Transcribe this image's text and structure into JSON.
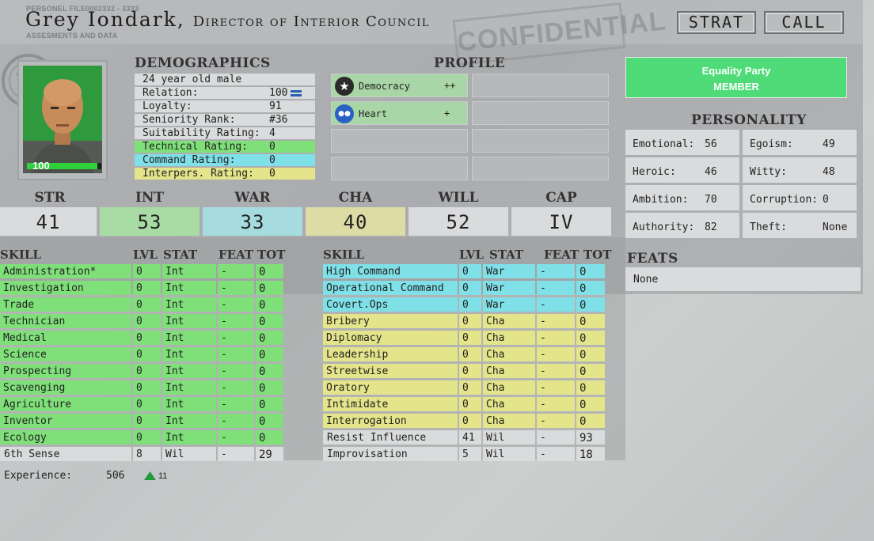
{
  "header": {
    "file_label": "PERSONEL FILE",
    "file_number": "0002332 - 3333",
    "sub_label": "ASSESMENTS AND DATA",
    "name": "Grey Iondark,",
    "role": "Director of Interior Council",
    "stamp": "CONFIDENTIAL",
    "strat_button": "STRAT",
    "call_button": "CALL"
  },
  "portrait": {
    "health": "100",
    "health_fraction": 0.95,
    "bar_color": "#2fd13a"
  },
  "demographics": {
    "title": "DEMOGRAPHICS",
    "rows": [
      {
        "label": "24 year old male",
        "value": "",
        "color": "w"
      },
      {
        "label": "Relation:",
        "value": "100",
        "color": "w",
        "icon": "equals-icon"
      },
      {
        "label": "Loyalty:",
        "value": "91",
        "color": "w"
      },
      {
        "label": "Seniority Rank:",
        "value": "#36",
        "color": "w"
      },
      {
        "label": "Suitability Rating:",
        "value": "4",
        "color": "w"
      },
      {
        "label": "Technical Rating:",
        "value": "0",
        "color": "g"
      },
      {
        "label": "Command Rating:",
        "value": "0",
        "color": "c"
      },
      {
        "label": "Interpers. Rating:",
        "value": "0",
        "color": "y"
      }
    ]
  },
  "profile": {
    "title": "PROFILE",
    "items": [
      {
        "label": "Democracy",
        "value": "++",
        "icon": "star-icon"
      },
      {
        "label": "Heart",
        "value": "+",
        "icon": "people-icon"
      }
    ]
  },
  "party": {
    "name": "Equality Party",
    "status": "MEMBER",
    "color": "#4fdc78"
  },
  "personality": {
    "title": "PERSONALITY",
    "items": [
      {
        "label": "Emotional:",
        "value": "56"
      },
      {
        "label": "Egoism:",
        "value": "49"
      },
      {
        "label": "Heroic:",
        "value": "46"
      },
      {
        "label": "Witty:",
        "value": "48"
      },
      {
        "label": "Ambition:",
        "value": "70"
      },
      {
        "label": "Corruption:",
        "value": "0"
      },
      {
        "label": "Authority:",
        "value": "82"
      },
      {
        "label": "Theft:",
        "value": "None"
      }
    ]
  },
  "feats": {
    "title": "FEATS",
    "value": "None"
  },
  "stats": [
    {
      "label": "STR",
      "value": "41",
      "color": "#d9dbdc"
    },
    {
      "label": "INT",
      "value": "53",
      "color": "#a9dca4"
    },
    {
      "label": "WAR",
      "value": "33",
      "color": "#a6dce0"
    },
    {
      "label": "CHA",
      "value": "40",
      "color": "#dcdca4"
    },
    {
      "label": "WILL",
      "value": "52",
      "color": "#d9dbdc"
    },
    {
      "label": "CAP",
      "value": "IV",
      "color": "#d9dbdc"
    }
  ],
  "skill_headers": {
    "skill": "SKILL",
    "lvl": "LVL",
    "stat": "STAT",
    "feat": "FEAT",
    "tot": "TOT"
  },
  "skills_left": [
    {
      "name": "Administration*",
      "lvl": "0",
      "stat": "Int",
      "feat": "-",
      "tot": "0",
      "color": "g"
    },
    {
      "name": "Investigation",
      "lvl": "0",
      "stat": "Int",
      "feat": "-",
      "tot": "0",
      "color": "g"
    },
    {
      "name": "Trade",
      "lvl": "0",
      "stat": "Int",
      "feat": "-",
      "tot": "0",
      "color": "g"
    },
    {
      "name": "Technician",
      "lvl": "0",
      "stat": "Int",
      "feat": "-",
      "tot": "0",
      "color": "g"
    },
    {
      "name": "Medical",
      "lvl": "0",
      "stat": "Int",
      "feat": "-",
      "tot": "0",
      "color": "g"
    },
    {
      "name": "Science",
      "lvl": "0",
      "stat": "Int",
      "feat": "-",
      "tot": "0",
      "color": "g"
    },
    {
      "name": "Prospecting",
      "lvl": "0",
      "stat": "Int",
      "feat": "-",
      "tot": "0",
      "color": "g"
    },
    {
      "name": "Scavenging",
      "lvl": "0",
      "stat": "Int",
      "feat": "-",
      "tot": "0",
      "color": "g"
    },
    {
      "name": "Agriculture",
      "lvl": "0",
      "stat": "Int",
      "feat": "-",
      "tot": "0",
      "color": "g"
    },
    {
      "name": "Inventor",
      "lvl": "0",
      "stat": "Int",
      "feat": "-",
      "tot": "0",
      "color": "g"
    },
    {
      "name": "Ecology",
      "lvl": "0",
      "stat": "Int",
      "feat": "-",
      "tot": "0",
      "color": "g"
    },
    {
      "name": "6th Sense",
      "lvl": "8",
      "stat": "Wil",
      "feat": "-",
      "tot": "29",
      "color": "w"
    }
  ],
  "skills_right": [
    {
      "name": "High Command",
      "lvl": "0",
      "stat": "War",
      "feat": "-",
      "tot": "0",
      "color": "c"
    },
    {
      "name": "Operational Command",
      "lvl": "0",
      "stat": "War",
      "feat": "-",
      "tot": "0",
      "color": "c"
    },
    {
      "name": "Covert.Ops",
      "lvl": "0",
      "stat": "War",
      "feat": "-",
      "tot": "0",
      "color": "c"
    },
    {
      "name": "Bribery",
      "lvl": "0",
      "stat": "Cha",
      "feat": "-",
      "tot": "0",
      "color": "y"
    },
    {
      "name": "Diplomacy",
      "lvl": "0",
      "stat": "Cha",
      "feat": "-",
      "tot": "0",
      "color": "y"
    },
    {
      "name": "Leadership",
      "lvl": "0",
      "stat": "Cha",
      "feat": "-",
      "tot": "0",
      "color": "y"
    },
    {
      "name": "Streetwise",
      "lvl": "0",
      "stat": "Cha",
      "feat": "-",
      "tot": "0",
      "color": "y"
    },
    {
      "name": "Oratory",
      "lvl": "0",
      "stat": "Cha",
      "feat": "-",
      "tot": "0",
      "color": "y"
    },
    {
      "name": "Intimidate",
      "lvl": "0",
      "stat": "Cha",
      "feat": "-",
      "tot": "0",
      "color": "y"
    },
    {
      "name": "Interrogation",
      "lvl": "0",
      "stat": "Cha",
      "feat": "-",
      "tot": "0",
      "color": "y"
    },
    {
      "name": "Resist Influence",
      "lvl": "41",
      "stat": "Wil",
      "feat": "-",
      "tot": "93",
      "color": "w"
    },
    {
      "name": "Improvisation",
      "lvl": "5",
      "stat": "Wil",
      "feat": "-",
      "tot": "18",
      "color": "w"
    }
  ],
  "experience": {
    "label": "Experience:",
    "value": "506",
    "gain": "11",
    "icon": "up-arrow-icon"
  }
}
